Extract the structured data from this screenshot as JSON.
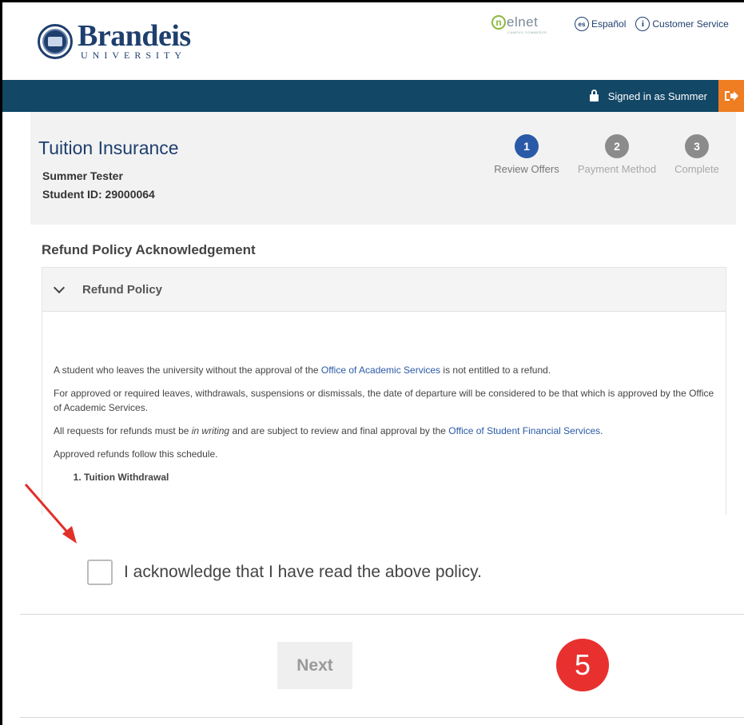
{
  "header": {
    "logo_name": "Brandeis",
    "logo_sub": "UNIVERSITY",
    "nelnet_word": "elnet",
    "nelnet_letter": "n",
    "nelnet_tag": "CAMPUS COMMERCE",
    "lang_icon_text": "es",
    "lang_label": "Español",
    "service_icon_text": "i",
    "service_label": "Customer Service"
  },
  "navbar": {
    "signed_in": "Signed in as Summer",
    "logout_icon": "logout-icon"
  },
  "summary": {
    "title": "Tuition Insurance",
    "name": "Summer Tester",
    "student_id": "Student ID: 29000064"
  },
  "steps": [
    {
      "number": "1",
      "label": "Review Offers",
      "state": "active"
    },
    {
      "number": "2",
      "label": "Payment Method",
      "state": "inactive"
    },
    {
      "number": "3",
      "label": "Complete",
      "state": "inactive"
    }
  ],
  "content": {
    "section_title": "Refund Policy Acknowledgement",
    "accordion_title": "Refund Policy",
    "p1_before": "A student who leaves the university without the approval of the ",
    "p1_link": "Office of Academic Services",
    "p1_after": " is not entitled to a refund.",
    "p2": "For approved or required leaves, withdrawals, suspensions or dismissals, the date of departure will be considered to be that which is approved by the Office of Academic Services.",
    "p3_before": "All requests for refunds must be ",
    "p3_em": "in writing",
    "p3_middle": " and are subject to review and final approval by the ",
    "p3_link": "Office of Student Financial Services",
    "p3_after": ".",
    "p4": "Approved refunds follow this schedule.",
    "list_item_1": "Tuition Withdrawal"
  },
  "acknowledge": {
    "label": "I acknowledge that I have read the above policy.",
    "checked": false
  },
  "actions": {
    "next_label": "Next"
  },
  "annotation": {
    "step_badge": "5"
  },
  "colors": {
    "brand_navy": "#1e3f6e",
    "navbar": "#124766",
    "logout_orange": "#ef7d22",
    "step_active": "#2a5aa7",
    "badge_red": "#e8312f",
    "arrow_red": "#e0302a"
  }
}
